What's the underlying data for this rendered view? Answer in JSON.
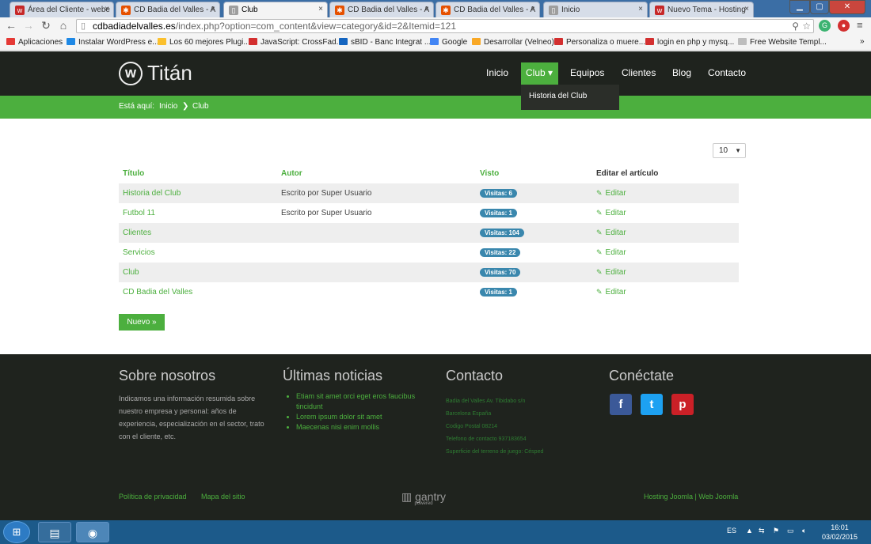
{
  "browser": {
    "tabs": [
      {
        "title": "Área del Cliente - webe",
        "icon": "w",
        "color": "#c62828",
        "active": false
      },
      {
        "title": "CD Badia del Valles - A",
        "icon": "joomla",
        "color": "#e65100",
        "active": false
      },
      {
        "title": "Club",
        "icon": "page",
        "color": "#9e9e9e",
        "active": true
      },
      {
        "title": "CD Badia del Valles - A",
        "icon": "joomla",
        "color": "#e65100",
        "active": false
      },
      {
        "title": "CD Badia del Valles - A",
        "icon": "joomla",
        "color": "#e65100",
        "active": false
      },
      {
        "title": "Inicio",
        "icon": "page",
        "color": "#9e9e9e",
        "active": false
      },
      {
        "title": "Nuevo Tema - Hosting",
        "icon": "w",
        "color": "#c62828",
        "active": false
      }
    ],
    "tab_close": "×",
    "url_host": "cdbadiadelvalles.es",
    "url_path": "/index.php?option=com_content&view=category&id=2&Itemid=121",
    "bookmarks": [
      {
        "label": "Aplicaciones",
        "color": "#e53935"
      },
      {
        "label": "Instalar WordPress e...",
        "color": "#1e88e5"
      },
      {
        "label": "Los 60 mejores Plugi...",
        "color": "#fbc02d"
      },
      {
        "label": "JavaScript: CrossFad...",
        "color": "#d32f2f"
      },
      {
        "label": "sBID - Banc Integrat ...",
        "color": "#1565c0"
      },
      {
        "label": "Google",
        "color": "#4285f4"
      },
      {
        "label": "Desarrollar (Velneo)",
        "color": "#f9a825"
      },
      {
        "label": "Personaliza o muere...",
        "color": "#d32f2f"
      },
      {
        "label": "login en php y mysq...",
        "color": "#d32f2f"
      },
      {
        "label": "Free Website Templ...",
        "color": "#bdbdbd"
      }
    ],
    "bookmarks_more": "»"
  },
  "site": {
    "logo_text": "Titán",
    "logo_mark": "w",
    "nav": [
      {
        "label": "Inicio"
      },
      {
        "label": "Club ▾"
      },
      {
        "label": "Equipos"
      },
      {
        "label": "Clientes"
      },
      {
        "label": "Blog"
      },
      {
        "label": "Contacto"
      }
    ],
    "dropdown_item": "Historia del Club",
    "breadcrumb": {
      "prefix": "Está aquí:",
      "home": "Inicio",
      "sep": "❯",
      "current": "Club"
    },
    "accent_color": "#4caf3e"
  },
  "category": {
    "limit_value": "10",
    "columns": {
      "title": "Título",
      "author": "Autor",
      "hits": "Visto",
      "edit": "Editar el artículo"
    },
    "rows": [
      {
        "title": "Historia del Club",
        "author": "Escrito por Super Usuario",
        "hits": "Visitas: 6",
        "edit": "Editar"
      },
      {
        "title": "Futbol 11",
        "author": "Escrito por Super Usuario",
        "hits": "Visitas: 1",
        "edit": "Editar"
      },
      {
        "title": "Clientes",
        "author": "",
        "hits": "Visitas: 104",
        "edit": "Editar"
      },
      {
        "title": "Servicios",
        "author": "",
        "hits": "Visitas: 22",
        "edit": "Editar"
      },
      {
        "title": "Club",
        "author": "",
        "hits": "Visitas: 70",
        "edit": "Editar"
      },
      {
        "title": "CD Badia del Valles",
        "author": "",
        "hits": "Visitas: 1",
        "edit": "Editar"
      }
    ],
    "new_button": "Nuevo »"
  },
  "footer": {
    "about_title": "Sobre nosotros",
    "about_text": "Indicamos una información resumida sobre nuestro empresa y personal: años de experiencia, especialización en el sector, trato con el cliente, etc.",
    "news_title": "Últimas noticias",
    "news": [
      "Etiam sit amet orci eget eros faucibus tincidunt",
      "Lorem ipsum dolor sit amet",
      "Maecenas nisi enim mollis"
    ],
    "contact_title": "Contacto",
    "contact": [
      "Badia del Valles Av. Tibidabo s/n",
      "Barcelona España",
      "Codigo Postal 08214",
      "Telefono de contacto 937183654",
      "Superficie del terreno de juego: Césped"
    ],
    "social_title": "Conéctate",
    "social": [
      {
        "name": "facebook",
        "glyph": "f",
        "color": "#3b5998"
      },
      {
        "name": "twitter",
        "glyph": "t",
        "color": "#1da1f2"
      },
      {
        "name": "pinterest",
        "glyph": "p",
        "color": "#cb2027"
      }
    ],
    "links": [
      "Política de privacidad",
      "Mapa del sitio"
    ],
    "powered": "gantry",
    "powered_sub": "powered",
    "credit": "Hosting Joomla | Web Joomla"
  },
  "taskbar": {
    "lang": "ES",
    "time": "16:01",
    "date": "03/02/2015"
  }
}
